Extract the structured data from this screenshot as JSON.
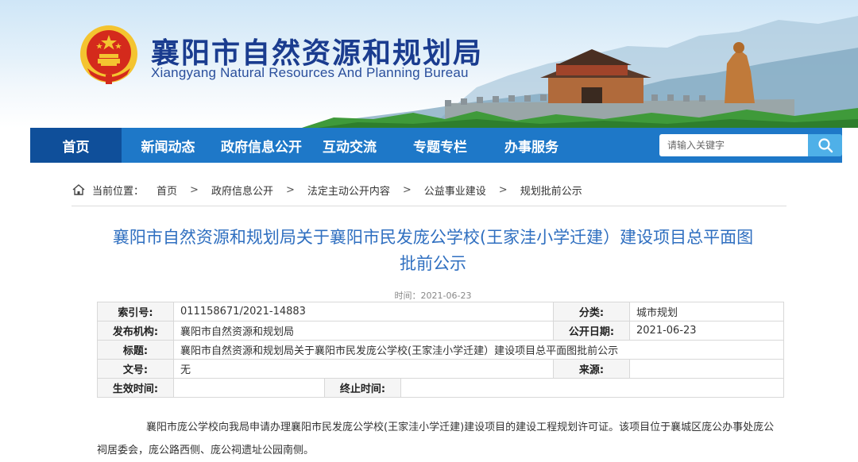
{
  "header": {
    "title": "襄阳市自然资源和规划局",
    "subtitle": "Xiangyang Natural Resources And Planning Bureau",
    "colors": {
      "title": "#1a3c8f",
      "emblem_red": "#d42a1c",
      "emblem_gold": "#f4c430"
    }
  },
  "nav": {
    "items": [
      {
        "label": "首页",
        "active": true
      },
      {
        "label": "新闻动态"
      },
      {
        "label": "政府信息公开"
      },
      {
        "label": "互动交流"
      },
      {
        "label": "专题专栏"
      },
      {
        "label": "办事服务"
      }
    ],
    "search_placeholder": "请输入关键字",
    "search_icon": "search-icon",
    "colors": {
      "bar": "#1e78c8",
      "active": "#0f4f9a",
      "search_button": "#4fb0e8"
    }
  },
  "breadcrumb": {
    "icon": "home-icon",
    "label": "当前位置：",
    "items": [
      "首页",
      "政府信息公开",
      "法定主动公开内容",
      "公益事业建设",
      "规划批前公示"
    ],
    "separator": ">"
  },
  "article": {
    "title_line1": "襄阳市自然资源和规划局关于襄阳市民发庞公学校(王家洼小学迁建）建设项目总平面图",
    "title_line2": "批前公示",
    "time": "时间：2021-06-23",
    "color": "#2f6fc0"
  },
  "meta": {
    "index_key": "索引号:",
    "index_val": "011158671/2021-14883",
    "category_key": "分类:",
    "category_val": "城市规划",
    "publisher_key": "发布机构:",
    "publisher_val": "襄阳市自然资源和规划局",
    "date_key": "公开日期:",
    "date_val": "2021-06-23",
    "title_key": "标题:",
    "title_val": "襄阳市自然资源和规划局关于襄阳市民发庞公学校(王家洼小学迁建）建设项目总平面图批前公示",
    "docno_key": "文号:",
    "docno_val": "无",
    "source_key": "来源:",
    "source_val": "",
    "effective_key": "生效时间:",
    "effective_val": "",
    "end_key": "终止时间:",
    "end_val": ""
  },
  "body": {
    "paragraph": "襄阳市庞公学校向我局申请办理襄阳市民发庞公学校(王家洼小学迁建)建设项目的建设工程规划许可证。该项目位于襄城区庞公办事处庞公祠居委会，庞公路西侧、庞公祠遗址公园南侧。"
  }
}
